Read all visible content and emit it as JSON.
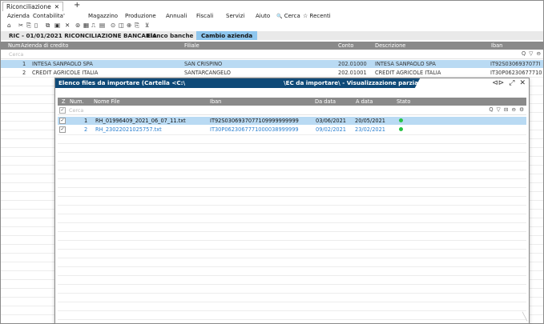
{
  "window": {
    "tab_label": "Riconciliazione",
    "tab_close": "✕",
    "tab_add": "+"
  },
  "menu": {
    "items": [
      "Azienda",
      "Contabilita'",
      "Magazzino",
      "Produzione",
      "Annuali",
      "Fiscali",
      "Servizi",
      "Aiuto",
      "Cerca",
      "Recenti"
    ],
    "search_icon": "🔍",
    "recent_icon": "☆"
  },
  "toolbar": {
    "icons": [
      "home-icon",
      "cut-icon",
      "copy-icon",
      "paste-icon",
      "copy-special-icon",
      "window-icon",
      "close-window-icon",
      "tools-icon",
      "report-icon",
      "window-list-icon",
      "calendar-icon",
      "settings-icon",
      "network-icon",
      "share-icon",
      "cart-icon"
    ]
  },
  "breadcrumb": {
    "title": "RIC - 01/01/2021  RICONCILIAZIONE BANCARIA",
    "tabs": [
      "Elenco banche",
      "Cambio azienda"
    ]
  },
  "main_grid": {
    "columns": [
      "Num",
      "Azienda di credito",
      "Filiale",
      "Conto",
      "Descrizione",
      "Iban"
    ],
    "filter_placeholder": "Cerca",
    "filter_icons": "Q ▽ ⊖",
    "rows": [
      {
        "num": "1",
        "azienda": "INTESA SANPAOLO SPA",
        "filiale": "SAN CRISPINO",
        "conto": "202.01000",
        "descrizione": "INTESA SANPAOLO SPA",
        "iban": "IT92S0306937077I"
      },
      {
        "num": "2",
        "azienda": "CREDIT AGRICOLE ITALIA",
        "filiale": "SANTARCANGELO",
        "conto": "202.01001",
        "descrizione": "CREDIT AGRICOLE ITALIA",
        "iban": "IT30P06230677710"
      }
    ]
  },
  "dialog": {
    "title_left": "Elenco files da importare (Cartella <C:\\",
    "title_right": "\\EC da importare\\ - Visualizzazione parziale)",
    "controls": [
      "⊲⊳",
      "⤢",
      "✕"
    ],
    "columns": [
      "Z",
      "Num.",
      "Nome File",
      "Iban",
      "Da data",
      "A data",
      "Stato"
    ],
    "filter_placeholder": "Cerca",
    "filter_icons": "Q ▽ ⊟ ⊖ ⚙",
    "rows": [
      {
        "check": "✓",
        "num": "1",
        "file": "RH_01996409_2021_06_07_11.txt",
        "iban": "IT92S0306937077109999999999",
        "da": "03/06/2021",
        "a": "20/05/2021",
        "status_color": "#25c244"
      },
      {
        "check": "✓",
        "num": "2",
        "file": "RH_23022021025757.txt",
        "iban": "IT30P0623067771000038999999",
        "da": "09/02/2021",
        "a": "23/02/2021",
        "status_color": "#25c244"
      }
    ],
    "corner_icon": "╲"
  }
}
